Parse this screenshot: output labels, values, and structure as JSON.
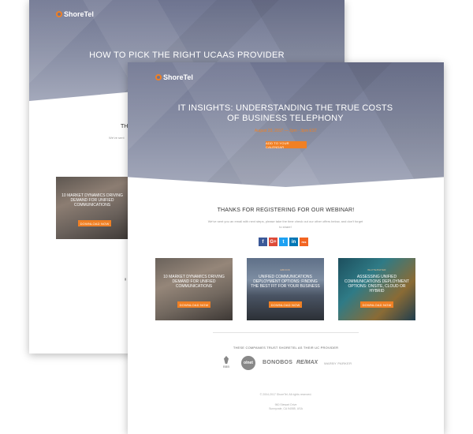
{
  "back_page": {
    "brand": "ShoreTel",
    "headline": "HOW TO PICK THE RIGHT UCAAS PROVIDER",
    "thanks_partial": "TH",
    "sub_partial": "We've sent",
    "card": {
      "title": "10 MARKET DYNAMICS DRIVING DEMAND FOR UNIFIED COMMUNICATIONS",
      "button": "DOWNLOAD NOW"
    }
  },
  "front_page": {
    "brand": "ShoreTel",
    "title": "IT INSIGHTS: UNDERSTANDING THE TRUE COSTS OF BUSINESS TELEPHONY",
    "date_line": "August 23, 2017 — 2pm - 3pm EST",
    "calendar_button": "ADD TO YOUR CALENDAR",
    "thanks_heading": "THANKS FOR REGISTERING FOR OUR WEBINAR!",
    "subtext": "We've sent you an email with next steps, please take the time check out our other offers below, and don't forget to share!",
    "social": [
      "f",
      "G+",
      "t",
      "in",
      "rss"
    ],
    "cards": [
      {
        "tag": "",
        "title": "10 MARKET DYNAMICS DRIVING DEMAND FOR UNIFIED COMMUNICATIONS",
        "button": "DOWNLOAD NOW"
      },
      {
        "tag": "EBOOK",
        "title": "UNIFIED COMMUNICATIONS DEPLOYMENT OPTIONS: FINDING THE BEST FIT FOR YOUR BUSINESS",
        "button": "DOWNLOAD NOW"
      },
      {
        "tag": "WHITEPAPER",
        "title": "ASSESSING UNIFIED COMMUNICATIONS DEPLOYMENT OPTIONS: ONSITE, CLOUD OR HYBRID",
        "button": "DOWNLOAD NOW"
      }
    ],
    "trust_heading": "THESE COMPANIES TRUST SHORETEL AS THEIR UC PROVIDER",
    "client_logos": {
      "bbb": "BBB",
      "olnet": "olnet",
      "bonobos": "BONOBOS",
      "remax": "RE/MAX",
      "warby": "WARBY PARKER"
    },
    "copyright": "© 2004-2017 ShoreTel. All rights reserved.",
    "address_line1": "960 Stewart Drive",
    "address_line2": "Sunnyvale, CA 94085, USA"
  },
  "colors": {
    "accent": "#f08024",
    "hero": "#7a8097",
    "facebook": "#3b5998",
    "google": "#dd4b39",
    "twitter": "#1da1f2",
    "linkedin": "#0077b5",
    "rss": "#f26522"
  }
}
